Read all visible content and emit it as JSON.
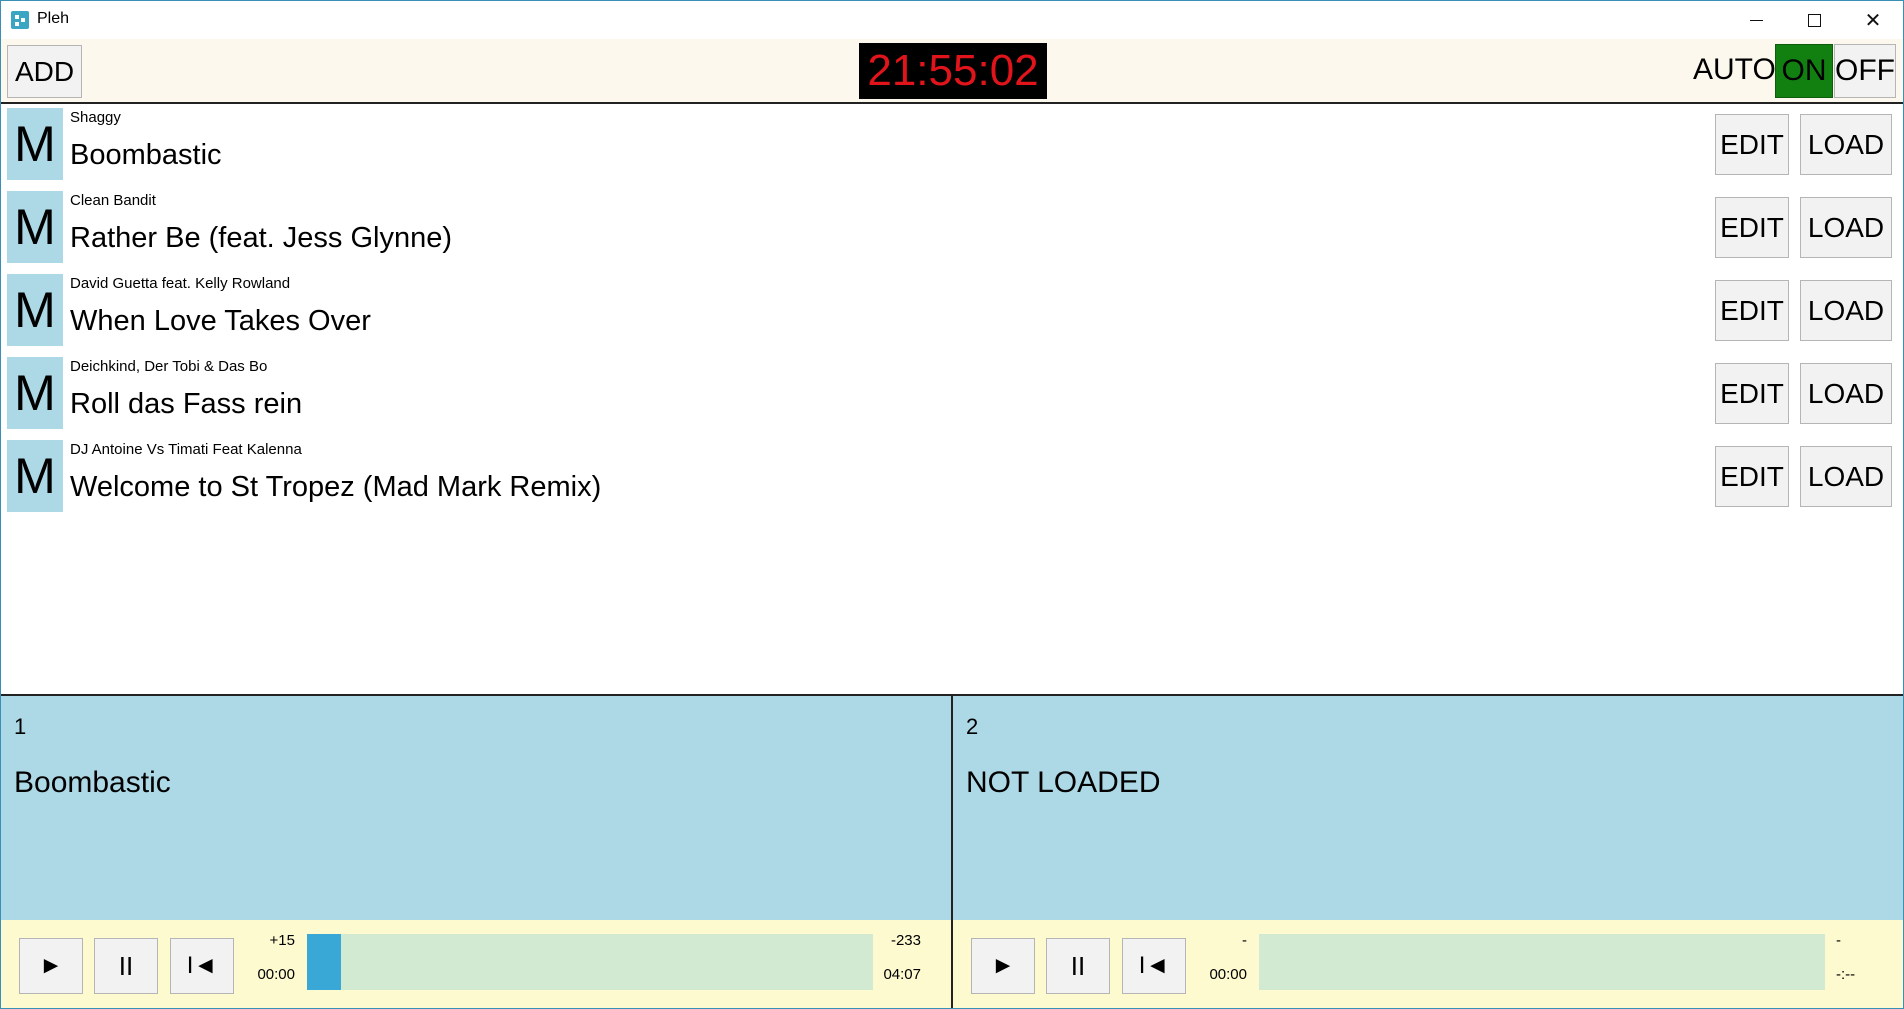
{
  "window": {
    "title": "Pleh",
    "minimize": "—",
    "maximize": "□",
    "close": "✕"
  },
  "toolbar": {
    "add_label": "ADD",
    "clock": "21:55:02",
    "auto_label": "AUTO",
    "on_label": "ON",
    "off_label": "OFF",
    "auto_state": "ON"
  },
  "tracks": [
    {
      "icon_letter": "M",
      "artist": "Shaggy",
      "title": "Boombastic",
      "edit_label": "EDIT",
      "load_label": "LOAD"
    },
    {
      "icon_letter": "M",
      "artist": "Clean Bandit",
      "title": "Rather Be (feat. Jess Glynne)",
      "edit_label": "EDIT",
      "load_label": "LOAD"
    },
    {
      "icon_letter": "M",
      "artist": "David Guetta feat. Kelly Rowland",
      "title": "When Love Takes Over",
      "edit_label": "EDIT",
      "load_label": "LOAD"
    },
    {
      "icon_letter": "M",
      "artist": "Deichkind, Der Tobi & Das Bo",
      "title": "Roll das Fass rein",
      "edit_label": "EDIT",
      "load_label": "LOAD"
    },
    {
      "icon_letter": "M",
      "artist": "DJ Antoine Vs Timati Feat Kalenna",
      "title": "Welcome to St Tropez (Mad Mark Remix)",
      "edit_label": "EDIT",
      "load_label": "LOAD"
    }
  ],
  "decks": [
    {
      "number": "1",
      "title": "Boombastic",
      "play": "►",
      "pause": "II",
      "rewind": "I◄",
      "left_top": "+15",
      "left_bottom": "00:00",
      "right_top": "-233",
      "right_bottom": "04:07",
      "progress": 0.06
    },
    {
      "number": "2",
      "title": "NOT LOADED",
      "play": "►",
      "pause": "II",
      "rewind": "I◄",
      "left_top": "-",
      "left_bottom": "00:00",
      "right_top": "-",
      "right_bottom": "-:--",
      "progress": 0
    }
  ],
  "colors": {
    "deck_bg": "#add8e6",
    "controls_bg": "#fdfad0",
    "toolbar_bg": "#fdf8ee",
    "clock_text": "#e0141a",
    "on_active": "#118011",
    "progress_fill": "#39a8d6",
    "progress_track": "#d1ead1"
  }
}
